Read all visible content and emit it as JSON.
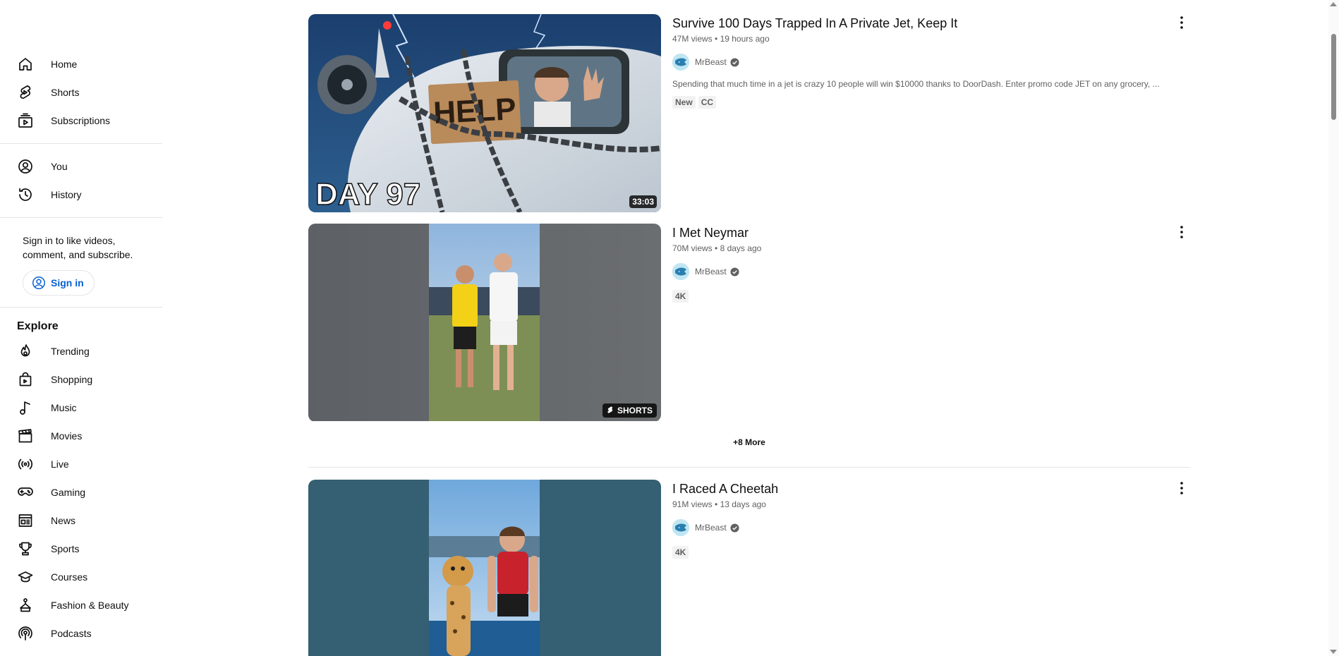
{
  "sidebar": {
    "primary": [
      {
        "label": "Home"
      },
      {
        "label": "Shorts"
      },
      {
        "label": "Subscriptions"
      }
    ],
    "you": [
      {
        "label": "You"
      },
      {
        "label": "History"
      }
    ],
    "signin": {
      "text": "Sign in to like videos, comment, and subscribe.",
      "button_label": "Sign in"
    },
    "explore": {
      "title": "Explore",
      "items": [
        {
          "label": "Trending"
        },
        {
          "label": "Shopping"
        },
        {
          "label": "Music"
        },
        {
          "label": "Movies"
        },
        {
          "label": "Live"
        },
        {
          "label": "Gaming"
        },
        {
          "label": "News"
        },
        {
          "label": "Sports"
        },
        {
          "label": "Courses"
        },
        {
          "label": "Fashion & Beauty"
        },
        {
          "label": "Podcasts"
        }
      ]
    }
  },
  "videos": [
    {
      "title": "Survive 100 Days Trapped In A Private Jet, Keep It",
      "views": "47M views",
      "age": "19 hours ago",
      "channel": "MrBeast",
      "description": "Spending that much time in a jet is crazy 10 people will win $10000 thanks to DoorDash. Enter promo code JET on any grocery, ...",
      "badges": [
        "New",
        "CC"
      ],
      "duration": "33:03",
      "thumb_text": "DAY 97",
      "sign_text": "HELP"
    },
    {
      "title": "I Met Neymar",
      "views": "70M views",
      "age": "8 days ago",
      "channel": "MrBeast",
      "badges": [
        "4K"
      ],
      "overlay": "SHORTS"
    },
    {
      "title": "I Raced A Cheetah",
      "views": "91M views",
      "age": "13 days ago",
      "channel": "MrBeast",
      "badges": [
        "4K"
      ]
    }
  ],
  "more_link": "+8 More",
  "meta_separator": "•"
}
